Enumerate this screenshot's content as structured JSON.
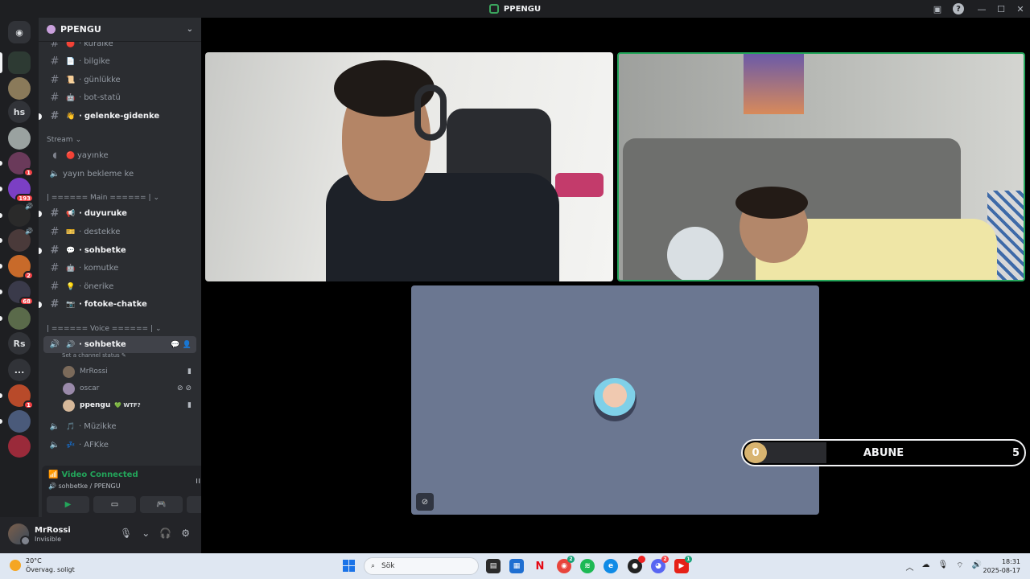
{
  "window": {
    "title": "PPENGU"
  },
  "server": {
    "name": "PPENGU"
  },
  "rail": {
    "text_items": [
      "hs",
      "Rs",
      "..."
    ],
    "badges": [
      "1",
      "193",
      "2",
      "68",
      "1"
    ]
  },
  "channels": {
    "top": [
      {
        "label": "kuralke",
        "emoji": "🔴"
      },
      {
        "label": "bilgike",
        "emoji": "📄"
      },
      {
        "label": "günlükke",
        "emoji": "📜"
      },
      {
        "label": "bot-statü",
        "emoji": "🤖"
      },
      {
        "label": "gelenke-gidenke",
        "emoji": "👋"
      }
    ],
    "stream_category": "Stream",
    "stream": [
      {
        "label": "yayınke",
        "emoji": "🔴"
      },
      {
        "label": "yayın bekleme ke",
        "emoji": ""
      }
    ],
    "main_category": "| ====== Main ====== |",
    "main": [
      {
        "label": "duyuruke",
        "emoji": "📢"
      },
      {
        "label": "destekke",
        "emoji": "🎫"
      },
      {
        "label": "sohbetke",
        "emoji": "💬"
      },
      {
        "label": "komutke",
        "emoji": "🤖"
      },
      {
        "label": "önerike",
        "emoji": "💡"
      },
      {
        "label": "fotoke-chatke",
        "emoji": "📷"
      }
    ],
    "voice_category": "| ====== Voice ====== |",
    "voice_active": {
      "label": "sohbetke",
      "status": "Set a channel status"
    },
    "voice_users": [
      {
        "name": "MrRossi"
      },
      {
        "name": "oscar"
      },
      {
        "name": "ppengu",
        "tag": "💚 WTF?"
      }
    ],
    "voice_more": [
      {
        "label": "Müzikke",
        "emoji": "🎵"
      },
      {
        "label": "AFKke",
        "emoji": "💤"
      }
    ]
  },
  "voice_panel": {
    "status": "Video Connected",
    "channel": "sohbetke / PPENGU"
  },
  "user_panel": {
    "name": "MrRossi",
    "status": "Invisible"
  },
  "overlay": {
    "left_count": "0",
    "label": "ABUNE",
    "right_count": "5"
  },
  "taskbar": {
    "weather_temp": "20°C",
    "weather_desc": "Övervag. soligt",
    "search_placeholder": "Sök",
    "time": "18:31",
    "date": "2025-08-17"
  },
  "colors": {
    "accent_green": "#23a55a",
    "sidebar_bg": "#2b2d31",
    "rail_bg": "#1e1f22",
    "tile_empty_bg": "#6b7791",
    "badge_red": "#f23f43"
  }
}
